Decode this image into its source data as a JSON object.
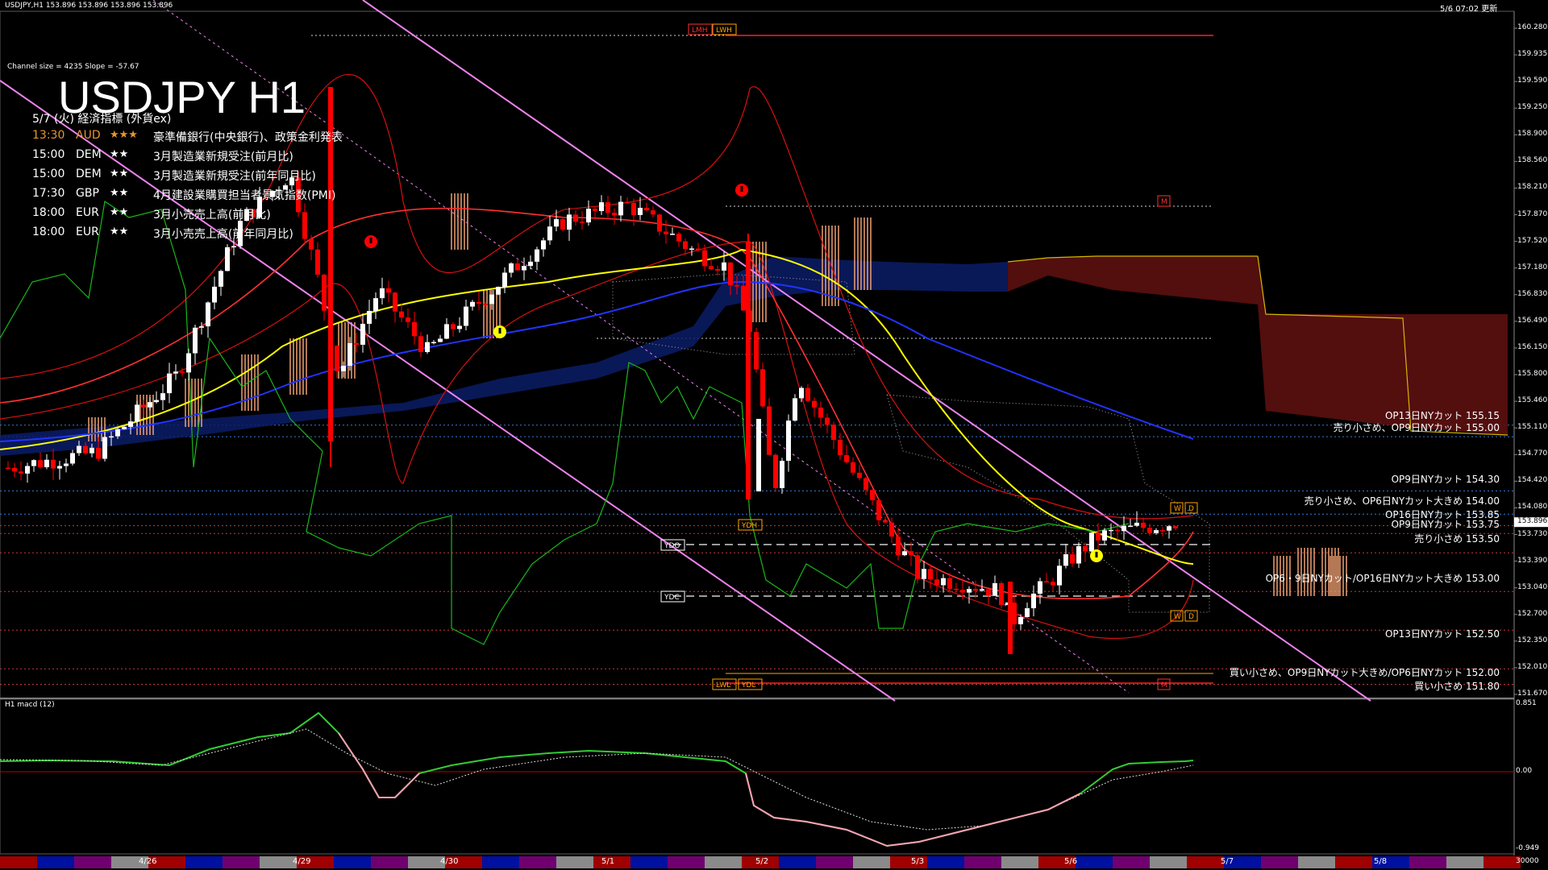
{
  "header": {
    "symbol_line": "USDJPY,H1  153.896 153.896 153.896 153.896",
    "updated": "5/6 07:02 更新",
    "channel_info": "Channel size = 4235 Slope = -57.67",
    "big_title": "USDJPY H1"
  },
  "events": {
    "heading": "5/7 (火) 経済指標 (外貨ex)",
    "items": [
      {
        "time": "13:30",
        "cur": "AUD",
        "stars": "★★★",
        "name": "豪準備銀行(中央銀行)、政策金利発表",
        "color": "#e8962e"
      },
      {
        "time": "15:00",
        "cur": "DEM",
        "stars": "★★",
        "name": "3月製造業新規受注(前月比)",
        "color": "#ffffff"
      },
      {
        "time": "15:00",
        "cur": "DEM",
        "stars": "★★",
        "name": "3月製造業新規受注(前年同月比)",
        "color": "#ffffff"
      },
      {
        "time": "17:30",
        "cur": "GBP",
        "stars": "★★",
        "name": "4月建設業購買担当者景気指数(PMI)",
        "color": "#ffffff"
      },
      {
        "time": "18:00",
        "cur": "EUR",
        "stars": "★★",
        "name": "3月小売売上高(前月比)",
        "color": "#ffffff"
      },
      {
        "time": "18:00",
        "cur": "EUR",
        "stars": "★★",
        "name": "3月小売売上高(前年同月比)",
        "color": "#ffffff"
      }
    ]
  },
  "orders": [
    {
      "text": "OP13日NYカット 155.15",
      "price": 155.15
    },
    {
      "text": "売り小さめ、OP9日NYカット 155.00",
      "price": 155.0
    },
    {
      "text": "OP9日NYカット 154.30",
      "price": 154.3
    },
    {
      "text": "売り小さめ、OP6日NYカット大きめ 154.00",
      "price": 154.0
    },
    {
      "text": "OP16日NYカット 153.85",
      "price": 153.85
    },
    {
      "text": "OP9日NYカット 153.75",
      "price": 153.75
    },
    {
      "text": "売り小さめ 153.50",
      "price": 153.5
    },
    {
      "text": "OP6・9日NYカット/OP16日NYカット大きめ 153.00",
      "price": 153.0
    },
    {
      "text": "OP13日NYカット 152.50",
      "price": 152.5
    },
    {
      "text": "買い小さめ、OP9日NYカット大きめ/OP6日NYカット 152.00",
      "price": 152.0
    },
    {
      "text": "買い小さめ 151.80",
      "price": 151.8
    }
  ],
  "tags": {
    "lwh": "LWH",
    "lmh": "LMH",
    "lwl": "LWL",
    "ydl": "YDL",
    "ydh": "YDH",
    "ydo": "YDO",
    "ydc": "YDC",
    "m": "M",
    "w": "W",
    "d": "D"
  },
  "price_axis": {
    "labels": [
      "160.280",
      "159.935",
      "159.590",
      "159.250",
      "158.900",
      "158.560",
      "158.210",
      "157.870",
      "157.520",
      "157.180",
      "156.830",
      "156.490",
      "156.150",
      "155.800",
      "155.460",
      "155.110",
      "154.770",
      "154.420",
      "154.080",
      "153.730",
      "153.390",
      "153.040",
      "152.700",
      "152.350",
      "152.010",
      "151.670"
    ],
    "current": "153.896"
  },
  "macd": {
    "label": "H1  macd (12)",
    "top": "0.851",
    "zero": "0.00",
    "bottom": "-0.949"
  },
  "time_axis": {
    "labels": [
      "4/26",
      "4/29",
      "4/30",
      "5/1",
      "5/2",
      "5/3",
      "5/6",
      "5/7",
      "5/8"
    ],
    "extra": "30000"
  },
  "colors": {
    "bull": "#ffffff",
    "bear": "#ff0000",
    "sma_short": "#ffff00",
    "sma_long": "#0000ff",
    "channel": "#ee82ee",
    "order_text": "#ffffff",
    "line_lead": "#00aa00",
    "macd_up": "#32cd32",
    "macd_down": "#ff9eb5"
  },
  "chart_data": {
    "type": "candlestick",
    "title": "USDJPY H1",
    "xlabel": "",
    "ylabel": "",
    "ylim": [
      151.67,
      160.28
    ],
    "grid": false,
    "x": [
      "4/26",
      "4/29",
      "4/30",
      "5/1",
      "5/2",
      "5/3",
      "5/6"
    ],
    "close_approx": [
      154.6,
      158.2,
      156.4,
      157.9,
      153.0,
      153.0,
      153.9
    ]
  }
}
